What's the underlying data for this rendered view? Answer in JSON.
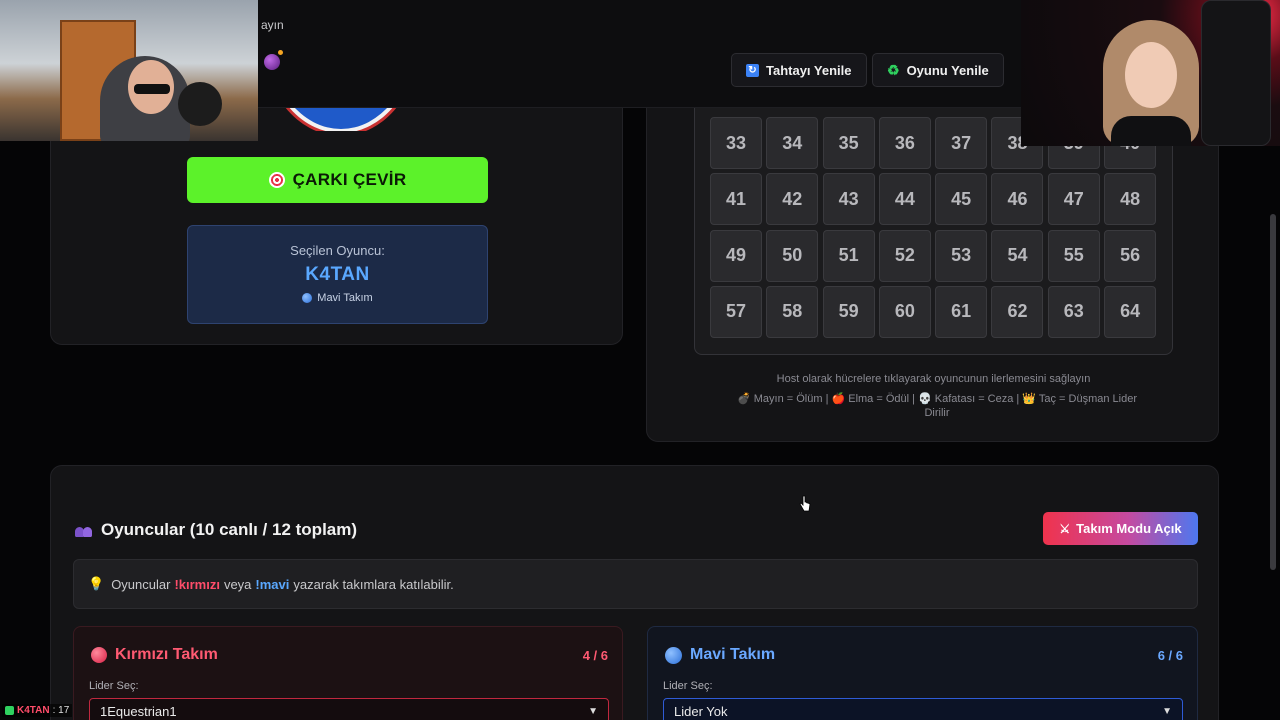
{
  "toolbar": {
    "partial_text": "ayın",
    "board_refresh_label": "Tahtayı Yenile",
    "game_refresh_label": "Oyunu Yenile"
  },
  "wheel": {
    "spin_label": "ÇARKI ÇEVİR",
    "selected_label": "Seçilen Oyuncu:",
    "selected_name": "K4TAN",
    "selected_team": "Mavi Takım"
  },
  "board": {
    "cells": [
      "33",
      "34",
      "35",
      "36",
      "37",
      "38",
      "39",
      "40",
      "41",
      "42",
      "43",
      "44",
      "45",
      "46",
      "47",
      "48",
      "49",
      "50",
      "51",
      "52",
      "53",
      "54",
      "55",
      "56",
      "57",
      "58",
      "59",
      "60",
      "61",
      "62",
      "63",
      "64"
    ],
    "host_hint": "Host olarak hücrelere tıklayarak oyuncunun ilerlemesini sağlayın",
    "legend": "💣 Mayın = Ölüm | 🍎 Elma = Ödül | 💀 Kafatası = Ceza | 👑 Taç = Düşman Lider Dirilir"
  },
  "players": {
    "title": "Oyuncular (10 canlı / 12 toplam)",
    "team_mode_label": "Takım Modu Açık",
    "info_prefix": "Oyuncular",
    "info_red_cmd": "!kırmızı",
    "info_mid": "veya",
    "info_blue_cmd": "!mavi",
    "info_suffix": "yazarak takımlara katılabilir.",
    "red_team": {
      "name": "Kırmızı Takım",
      "count": "4 / 6",
      "leader_label": "Lider Seç:",
      "leader_value": "1Equestrian1"
    },
    "blue_team": {
      "name": "Mavi Takım",
      "count": "6 / 6",
      "leader_label": "Lider Seç:",
      "leader_value": "Lider Yok"
    }
  },
  "chat": {
    "user": "K4TAN",
    "message": ": 17"
  },
  "colors": {
    "spin_green": "#5cf22a",
    "red_accent": "#ff5a72",
    "blue_accent": "#5aa8ff"
  }
}
